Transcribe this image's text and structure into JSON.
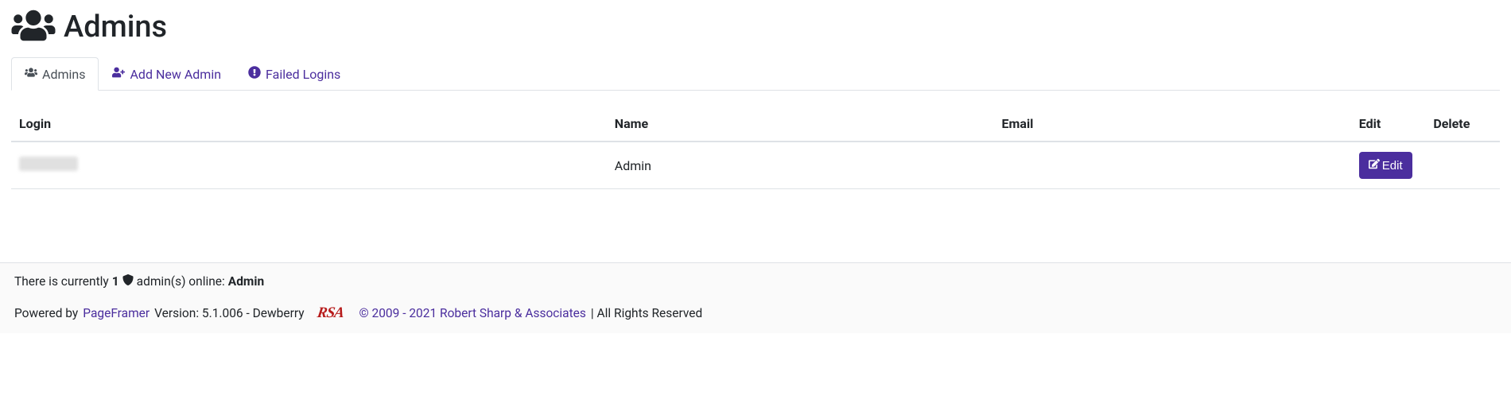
{
  "page": {
    "title": "Admins"
  },
  "tabs": {
    "admins": "Admins",
    "add_new": "Add New Admin",
    "failed_logins": "Failed Logins"
  },
  "table": {
    "headers": {
      "login": "Login",
      "name": "Name",
      "email": "Email",
      "edit": "Edit",
      "delete": "Delete"
    },
    "rows": [
      {
        "login": "",
        "name": "Admin",
        "email": "",
        "edit_label": "Edit"
      }
    ]
  },
  "footer": {
    "currently_prefix": "There is currently ",
    "admin_count": "1",
    "admins_online_text": " admin(s) online: ",
    "admin_name": "Admin",
    "powered_by": "Powered by ",
    "pageframer": "PageFramer",
    "version_text": " Version: 5.1.006 - Dewberry",
    "rsa": "RSA",
    "copyright_link": "© 2009 - 2021 Robert Sharp & Associates",
    "rights": " | All Rights Reserved"
  }
}
